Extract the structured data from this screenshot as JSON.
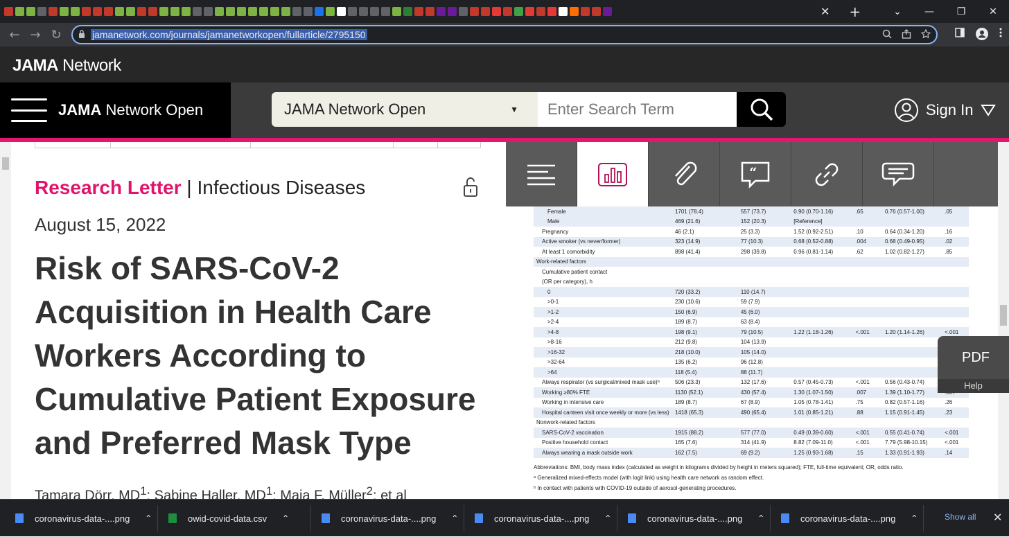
{
  "browser": {
    "tab_close": "✕",
    "tab_new": "+",
    "window_controls": [
      "⌄",
      "—",
      "❐",
      "✕"
    ],
    "url": "jamanetwork.com/journals/jamanetworkopen/fullarticle/2795150",
    "nav": {
      "back": "←",
      "forward": "→",
      "reload": "↻"
    }
  },
  "site": {
    "brand_bold": "JAMA",
    "brand_rest": " Network",
    "nav_title_bold": "JAMA",
    "nav_title_rest": " Network Open",
    "search_scope": "JAMA Network Open",
    "search_placeholder": "Enter Search Term",
    "sign_in": "Sign In",
    "accent_color": "#e7156f"
  },
  "article": {
    "kicker_type": "Research Letter",
    "kicker_sep": " | ",
    "kicker_topic": "Infectious Diseases",
    "date": "August 15, 2022",
    "title": "Risk of SARS-CoV-2 Acquisition in Health Care Workers According to Cumulative Patient Exposure and Preferred Mask Type",
    "authors_a1": "Tamara Dörr, MD",
    "authors_a1_sup": "1",
    "authors_a2": "; Sabine Haller, MD",
    "authors_a2_sup": "1",
    "authors_a3": "; Maja F. Müller",
    "authors_a3_sup": "2",
    "authors_sep": "; ",
    "authors_more": "et al"
  },
  "table": {
    "rows": [
      {
        "label": "Female",
        "c1": "1701 (78.4)",
        "c2": "557 (73.7)",
        "c3": "0.90 (0.70-1.16)",
        "c4": ".65",
        "c5": "0.76 (0.57-1.00)",
        "c6": ".05",
        "indent": 2,
        "shade": true
      },
      {
        "label": "Male",
        "c1": "469 (21.6)",
        "c2": "152 (20.3)",
        "c3": "[Reference]",
        "c4": "",
        "c5": "",
        "c6": "",
        "indent": 2,
        "shade": true
      },
      {
        "label": "Pregnancy",
        "c1": "46 (2.1)",
        "c2": "25 (3.3)",
        "c3": "1.52 (0.92-2.51)",
        "c4": ".10",
        "c5": "0.64 (0.34-1.20)",
        "c6": ".16",
        "indent": 1,
        "shade": false
      },
      {
        "label": "Active smoker (vs never/former)",
        "c1": "323 (14.9)",
        "c2": "77 (10.3)",
        "c3": "0.68 (0.52-0.88)",
        "c4": ".004",
        "c5": "0.68 (0.49-0.95)",
        "c6": ".02",
        "indent": 1,
        "shade": true
      },
      {
        "label": "At least 1 comorbidity",
        "c1": "898 (41.4)",
        "c2": "298 (39.8)",
        "c3": "0.96 (0.81-1.14)",
        "c4": ".62",
        "c5": "1.02 (0.82-1.27)",
        "c6": ".85",
        "indent": 1,
        "shade": false
      },
      {
        "label": "Work-related factors",
        "c1": "",
        "c2": "",
        "c3": "",
        "c4": "",
        "c5": "",
        "c6": "",
        "indent": 0,
        "shade": true
      },
      {
        "label": "Cumulative patient contact",
        "c1": "",
        "c2": "",
        "c3": "",
        "c4": "",
        "c5": "",
        "c6": "",
        "indent": 1,
        "shade": false
      },
      {
        "label": "(OR per category), h",
        "c1": "",
        "c2": "",
        "c3": "",
        "c4": "",
        "c5": "",
        "c6": "",
        "indent": 1,
        "shade": false
      },
      {
        "label": "0",
        "c1": "720 (33.2)",
        "c2": "110 (14.7)",
        "c3": "",
        "c4": "",
        "c5": "",
        "c6": "",
        "indent": 2,
        "shade": true
      },
      {
        "label": ">0-1",
        "c1": "230 (10.6)",
        "c2": "59 (7.9)",
        "c3": "",
        "c4": "",
        "c5": "",
        "c6": "",
        "indent": 2,
        "shade": false
      },
      {
        "label": ">1-2",
        "c1": "150 (6.9)",
        "c2": "45 (6.0)",
        "c3": "",
        "c4": "",
        "c5": "",
        "c6": "",
        "indent": 2,
        "shade": true
      },
      {
        "label": ">2-4",
        "c1": "189 (8.7)",
        "c2": "63 (8.4)",
        "c3": "",
        "c4": "",
        "c5": "",
        "c6": "",
        "indent": 2,
        "shade": false
      },
      {
        "label": ">4-8",
        "c1": "198 (9.1)",
        "c2": "79 (10.5)",
        "c3": "1.22 (1.18-1.26)",
        "c4": "<.001",
        "c5": "1.20 (1.14-1.26)",
        "c6": "<.001",
        "indent": 2,
        "shade": true
      },
      {
        "label": ">8-16",
        "c1": "212 (9.8)",
        "c2": "104 (13.9)",
        "c3": "",
        "c4": "",
        "c5": "",
        "c6": "",
        "indent": 2,
        "shade": false
      },
      {
        "label": ">16-32",
        "c1": "218 (10.0)",
        "c2": "105 (14.0)",
        "c3": "",
        "c4": "",
        "c5": "",
        "c6": "",
        "indent": 2,
        "shade": true
      },
      {
        "label": ">32-64",
        "c1": "135 (6.2)",
        "c2": "96 (12.8)",
        "c3": "",
        "c4": "",
        "c5": "",
        "c6": "",
        "indent": 2,
        "shade": false
      },
      {
        "label": ">64",
        "c1": "118 (5.4)",
        "c2": "88 (11.7)",
        "c3": "",
        "c4": "",
        "c5": "",
        "c6": "",
        "indent": 2,
        "shade": true
      },
      {
        "label": "Always respirator (vs surgical/mixed mask use)ᵇ",
        "c1": "506 (23.3)",
        "c2": "132 (17.6)",
        "c3": "0.57 (0.45-0.73)",
        "c4": "<.001",
        "c5": "0.56 (0.43-0.74)",
        "c6": "<.001",
        "indent": 1,
        "shade": false
      },
      {
        "label": "Working ≥80% FTE",
        "c1": "1130 (52.1)",
        "c2": "430 (57.4)",
        "c3": "1.30 (1.07-1.50)",
        "c4": ".007",
        "c5": "1.39 (1.10-1.77)",
        "c6": ".007",
        "indent": 1,
        "shade": true
      },
      {
        "label": "Working in intensive care",
        "c1": "189 (8.7)",
        "c2": "67 (8.9)",
        "c3": "1.05 (0.78-1.41)",
        "c4": ".75",
        "c5": "0.82 (0.57-1.16)",
        "c6": ".26",
        "indent": 1,
        "shade": false
      },
      {
        "label": "Hospital canteen visit once weekly or more (vs less)",
        "c1": "1418 (65.3)",
        "c2": "490 (65.4)",
        "c3": "1.01 (0.85-1.21)",
        "c4": ".88",
        "c5": "1.15 (0.91-1.45)",
        "c6": ".23",
        "indent": 1,
        "shade": true
      },
      {
        "label": "Nonwork-related factors",
        "c1": "",
        "c2": "",
        "c3": "",
        "c4": "",
        "c5": "",
        "c6": "",
        "indent": 0,
        "shade": false
      },
      {
        "label": "SARS-CoV-2 vaccination",
        "c1": "1915 (88.2)",
        "c2": "577 (77.0)",
        "c3": "0.49 (0.39-0.60)",
        "c4": "<.001",
        "c5": "0.55 (0.41-0.74)",
        "c6": "<.001",
        "indent": 1,
        "shade": true
      },
      {
        "label": "Positive household contact",
        "c1": "165 (7.6)",
        "c2": "314 (41.9)",
        "c3": "8.82 (7.09-11.0)",
        "c4": "<.001",
        "c5": "7.79 (5.98-10.15)",
        "c6": "<.001",
        "indent": 1,
        "shade": false
      },
      {
        "label": "Always wearing a mask outside work",
        "c1": "162 (7.5)",
        "c2": "69 (9.2)",
        "c3": "1.25 (0.93-1.68)",
        "c4": ".15",
        "c5": "1.33 (0.91-1.93)",
        "c6": ".14",
        "indent": 1,
        "shade": true
      }
    ],
    "footnote_abbrev": "Abbreviations: BMI, body mass index (calculated as weight in kilograms divided by height in meters squared); FTE, full-time equivalent; OR, odds ratio.",
    "footnote_a": "ᵃ Generalized mixed-effects model (with logit link) using health care network as random effect.",
    "footnote_b": "ᵇ In contact with patients with COVID-19 outside of aerosol-generating procedures."
  },
  "pdf": {
    "label": "PDF",
    "help": "Help"
  },
  "downloads": {
    "items": [
      {
        "name": "coronavirus-data-....png",
        "type": "png"
      },
      {
        "name": "owid-covid-data.csv",
        "type": "csv"
      },
      {
        "name": "coronavirus-data-....png",
        "type": "png"
      },
      {
        "name": "coronavirus-data-....png",
        "type": "png"
      },
      {
        "name": "coronavirus-data-....png",
        "type": "png"
      },
      {
        "name": "coronavirus-data-....png",
        "type": "png"
      }
    ],
    "show_all": "Show all",
    "close": "✕"
  }
}
